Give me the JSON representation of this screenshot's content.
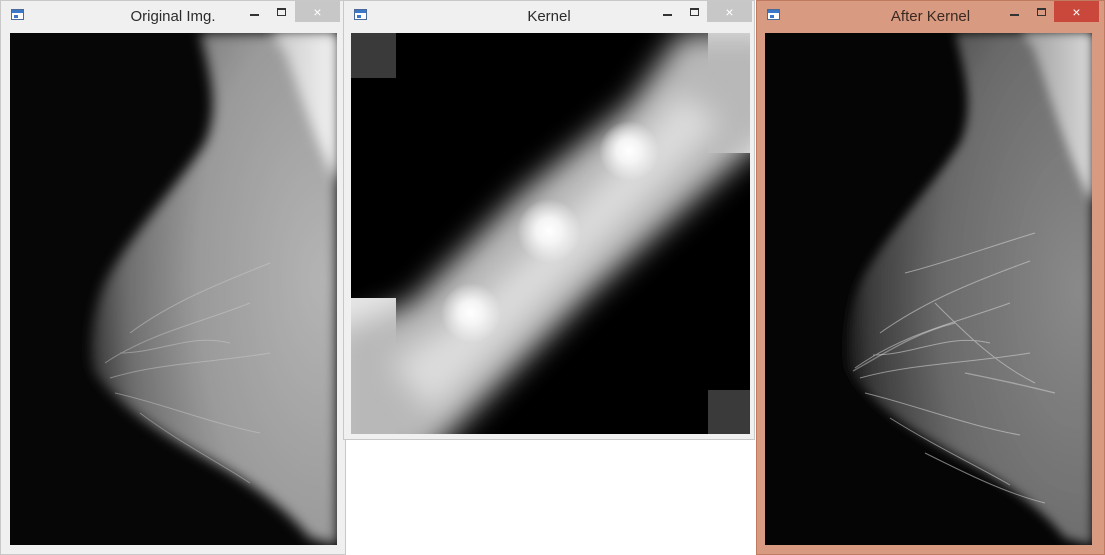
{
  "windows": [
    {
      "id": "original",
      "title": "Original Img.",
      "close_glyph": "×",
      "active": false
    },
    {
      "id": "kernel",
      "title": "Kernel",
      "close_glyph": "×",
      "active": false
    },
    {
      "id": "after",
      "title": "After Kernel",
      "close_glyph": "×",
      "active": true
    }
  ],
  "icons": {
    "app": "window-app-icon",
    "minimize": "minimize-icon",
    "maximize": "maximize-icon",
    "close": "close-icon"
  },
  "colors": {
    "active_frame": "#d99a82",
    "active_close": "#c9483b",
    "inactive_frame": "#f0f0f0",
    "inactive_close": "#c7c7c7"
  }
}
